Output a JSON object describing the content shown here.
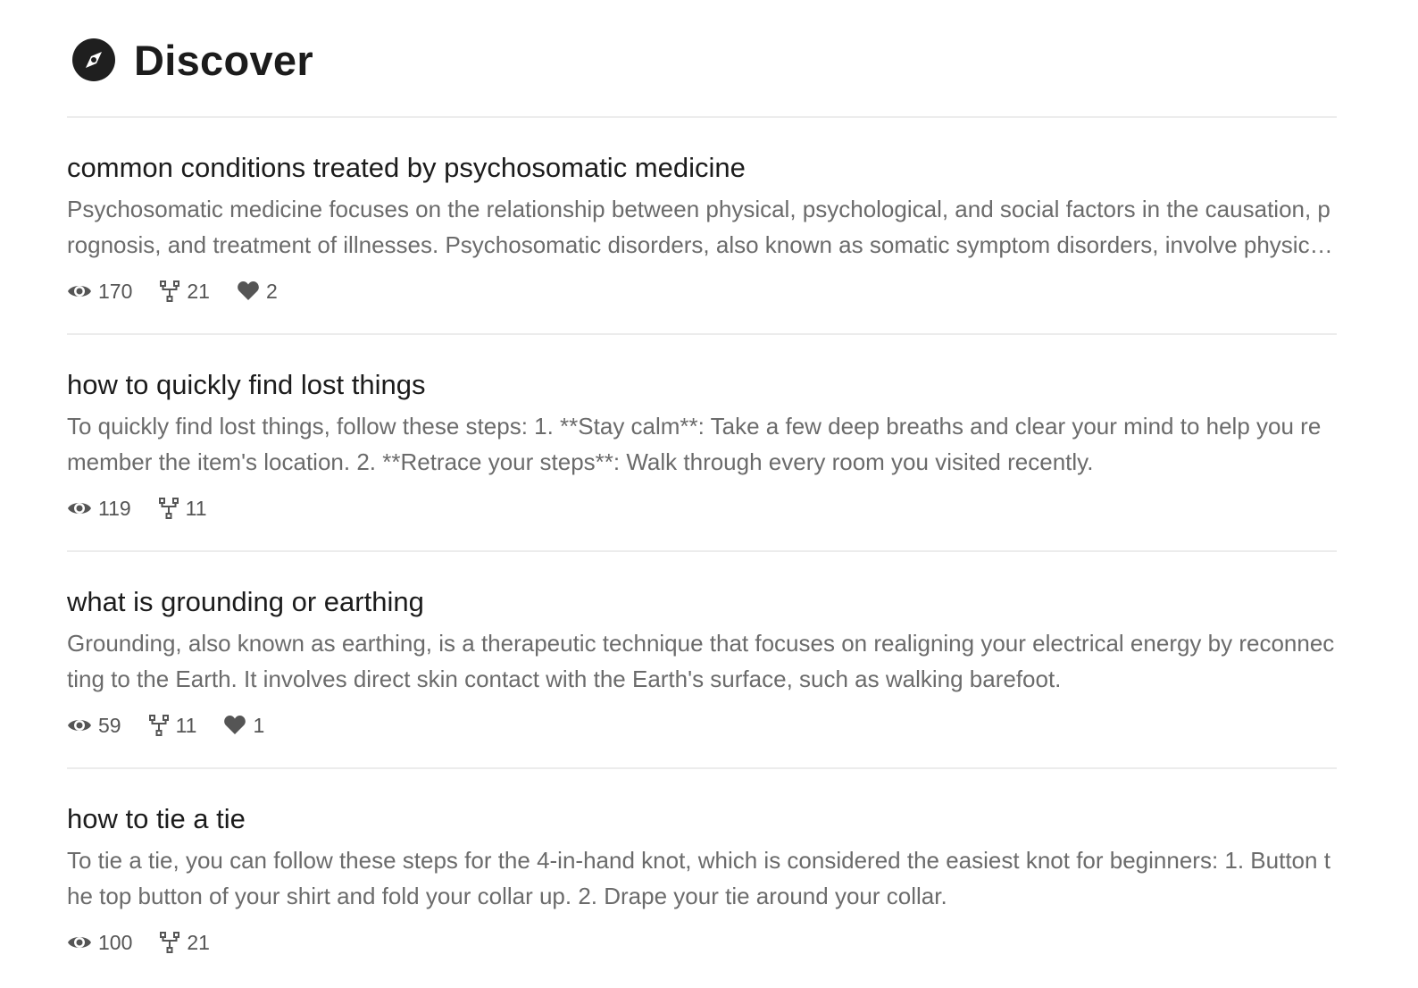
{
  "header": {
    "title": "Discover",
    "icon": "compass-icon"
  },
  "items": [
    {
      "title": "common conditions treated by psychosomatic medicine",
      "description": "Psychosomatic medicine focuses on the relationship between physical, psychological, and social factors in the causation, prognosis, and treatment of illnesses. Psychosomatic disorders, also known as somatic symptom disorders, involve physical symptoms that are influenced by psychological factors.",
      "views": "170",
      "forks": "21",
      "likes": "2"
    },
    {
      "title": "how to quickly find lost things",
      "description": "To quickly find lost things, follow these steps: 1. **Stay calm**: Take a few deep breaths and clear your mind to help you remember the item's location. 2. **Retrace your steps**: Walk through every room you visited recently.",
      "views": "119",
      "forks": "11",
      "likes": null
    },
    {
      "title": "what is grounding or earthing",
      "description": "Grounding, also known as earthing, is a therapeutic technique that focuses on realigning your electrical energy by reconnecting to the Earth. It involves direct skin contact with the Earth's surface, such as walking barefoot.",
      "views": "59",
      "forks": "11",
      "likes": "1"
    },
    {
      "title": "how to tie a tie",
      "description": "To tie a tie, you can follow these steps for the 4-in-hand knot, which is considered the easiest knot for beginners: 1. Button the top button of your shirt and fold your collar up. 2. Drape your tie around your collar.",
      "views": "100",
      "forks": "21",
      "likes": null
    }
  ],
  "colors": {
    "title": "#1c1c1c",
    "description": "#6b6b6b",
    "stats": "#555555",
    "divider": "#ececec"
  }
}
